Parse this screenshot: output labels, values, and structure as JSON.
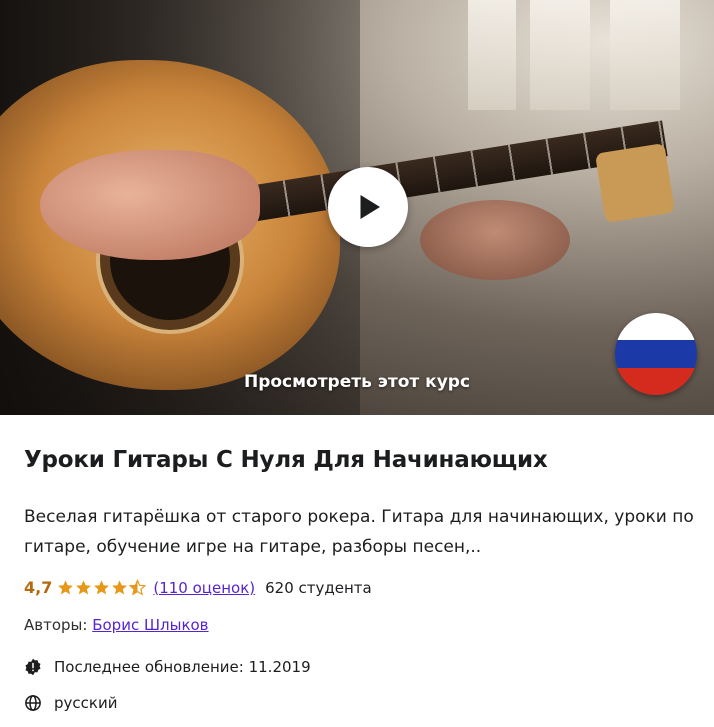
{
  "hero": {
    "preview_label": "Просмотреть этот курс",
    "play_icon": "play-icon",
    "language_flag": "russia-flag",
    "flag_colors": [
      "#ffffff",
      "#1c39a8",
      "#d52b1e"
    ]
  },
  "course": {
    "title": "Уроки Гитары С Нуля Для Начинающих",
    "description": "Веселая гитарёшка от старого рокера. Гитара для начинающих, уроки по гитаре, обучение игре на гитаре, разборы песен,..",
    "rating": "4,7",
    "rating_value": 4.7,
    "reviews_label": "(110 оценок)",
    "students_label": "620 студента",
    "authors_prefix": "Авторы:",
    "author_name": "Борис Шлыков",
    "updated_label": "Последнее обновление: 11.2019",
    "language_label": "русский"
  },
  "colors": {
    "star": "#e59819",
    "rating_text": "#b4690e",
    "link": "#5624d0"
  }
}
